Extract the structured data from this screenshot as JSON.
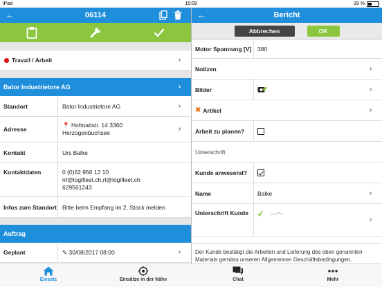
{
  "status_bar": {
    "device": "iPad",
    "time": "15:09",
    "battery": "39 %"
  },
  "left": {
    "title": "06114",
    "status_row": "Travail / Arbeit",
    "customer_section": "Bator Industrietore AG",
    "rows": [
      {
        "label": "Standort",
        "value": "Bator Industrietore AG"
      },
      {
        "label": "Adresse",
        "value1": "Hofmattstr. 14 3360",
        "value2": "Herzogenbuchsee"
      },
      {
        "label": "Kontakt",
        "value": "Urs Balke"
      },
      {
        "label": "Kontaktdaten",
        "lines": [
          "0 (0)62 956 12 10",
          "nf@logifleet.ch,rl@logifleet.ch",
          "629561243"
        ]
      },
      {
        "label": "Infos zum Standort",
        "value": "Bitte beim Empfang im 2. Stock melden"
      }
    ],
    "order_section": "Auftrag",
    "geplant": {
      "label": "Geplant",
      "value": "30/08/2017 08:00"
    }
  },
  "right": {
    "title": "Bericht",
    "cancel_label": "Abbrechen",
    "ok_label": "OK",
    "motor": {
      "label": "Motor Spannung [V]",
      "value": "380"
    },
    "notizen": "Notizen",
    "bilder": "Bilder",
    "artikel": "Artikel",
    "arbeit": "Arbeit zu planen?",
    "unterschrift": "Unterschrift",
    "kunde_anwesend": "Kunde anwesend?",
    "name": {
      "label": "Name",
      "value": "Balke"
    },
    "unterschrift_kunde": "Unterschrift Kunde",
    "legal": "Der Kunde bestätigt die Arbeiten und Lieferung des oben genannten Materials gemäss unseren Allgemeinen Geschäftsbedingungen."
  },
  "tabs": [
    {
      "label": "Einsatz",
      "icon": "home-icon"
    },
    {
      "label": "Einsätze in der Nähe",
      "icon": "location-icon"
    },
    {
      "label": "Chat",
      "icon": "chat-icon"
    },
    {
      "label": "Mehr",
      "icon": "more-icon"
    }
  ],
  "colors": {
    "accent_blue": "#1f8fdc",
    "accent_green": "#8cc63f",
    "status_red": "#e01010"
  }
}
